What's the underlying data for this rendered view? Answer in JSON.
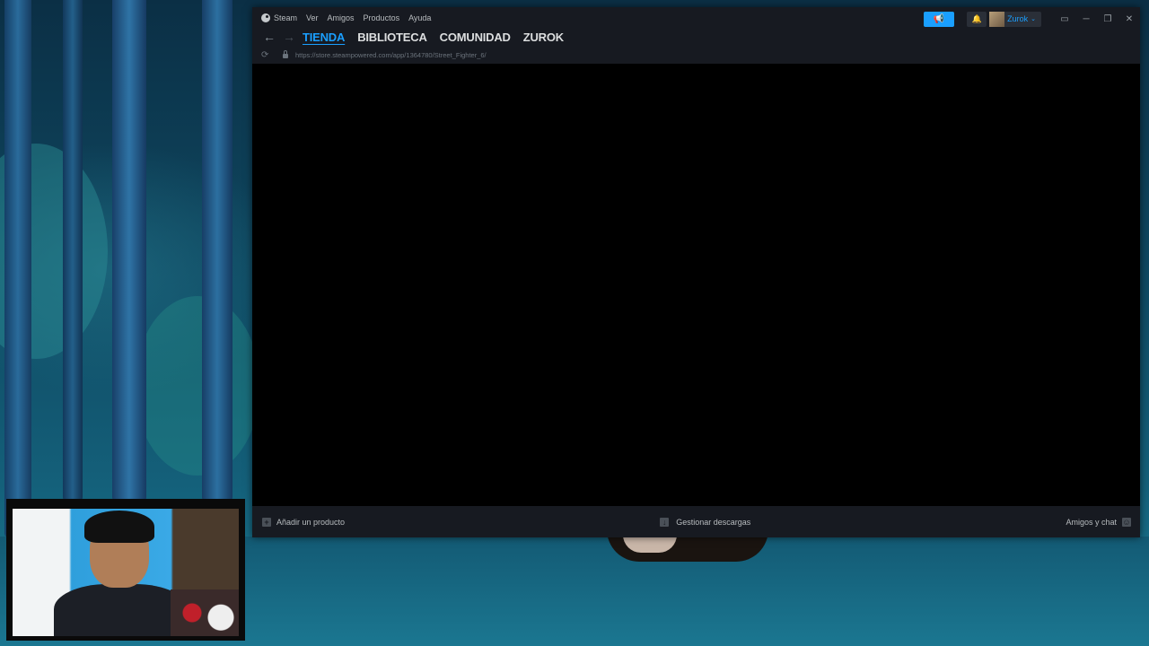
{
  "steam": {
    "menu": [
      {
        "label": "Steam",
        "icon": "steam-logo-icon"
      },
      {
        "label": "Ver"
      },
      {
        "label": "Amigos"
      },
      {
        "label": "Productos"
      },
      {
        "label": "Ayuda"
      }
    ],
    "user": {
      "name": "Zurok",
      "caret": "⌄"
    },
    "tabs": [
      "TIENDA",
      "BIBLIOTECA",
      "COMUNIDAD",
      "ZUROK"
    ],
    "active_tab": "TIENDA",
    "url": "https://store.steampowered.com/app/1364780/Street_Fighter_6/",
    "bottom_bar": {
      "add_product": "Añadir un producto",
      "manage_downloads": "Gestionar descargas",
      "friends_chat": "Amigos y chat"
    },
    "colors": {
      "accent": "#1a9fff",
      "window_bg": "#171a21",
      "content_bg": "#000000"
    }
  }
}
